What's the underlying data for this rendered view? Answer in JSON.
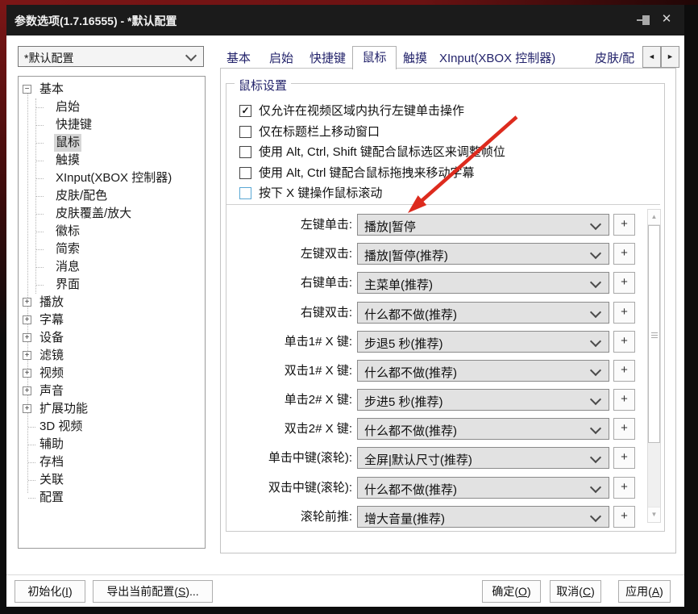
{
  "window": {
    "title": "参数选项(1.7.16555) - *默认配置",
    "icons": {
      "pin_icon": "pushpin",
      "close_icon": "✕"
    }
  },
  "profile_combo": {
    "value": "*默认配置"
  },
  "tree": {
    "items": [
      {
        "label": "基本",
        "expander": "−"
      },
      {
        "label": "启始",
        "expander": ""
      },
      {
        "label": "快捷键",
        "expander": ""
      },
      {
        "label": "鼠标",
        "expander": "",
        "selected": true
      },
      {
        "label": "触摸",
        "expander": ""
      },
      {
        "label": "XInput(XBOX 控制器)",
        "expander": ""
      },
      {
        "label": "皮肤/配色",
        "expander": ""
      },
      {
        "label": "皮肤覆盖/放大",
        "expander": ""
      },
      {
        "label": "徽标",
        "expander": ""
      },
      {
        "label": "简索",
        "expander": ""
      },
      {
        "label": "消息",
        "expander": ""
      },
      {
        "label": "界面",
        "expander": ""
      },
      {
        "label": "播放",
        "expander": "+"
      },
      {
        "label": "字幕",
        "expander": "+"
      },
      {
        "label": "设备",
        "expander": "+"
      },
      {
        "label": "滤镜",
        "expander": "+"
      },
      {
        "label": "视频",
        "expander": "+"
      },
      {
        "label": "声音",
        "expander": "+"
      },
      {
        "label": "扩展功能",
        "expander": "+"
      },
      {
        "label": "3D 视频",
        "expander": ""
      },
      {
        "label": "辅助",
        "expander": ""
      },
      {
        "label": "存档",
        "expander": ""
      },
      {
        "label": "关联",
        "expander": ""
      },
      {
        "label": "配置",
        "expander": ""
      }
    ]
  },
  "tabs": {
    "items": [
      {
        "label": "基本"
      },
      {
        "label": "启始"
      },
      {
        "label": "快捷键"
      },
      {
        "label": "鼠标",
        "active": true
      },
      {
        "label": "触摸"
      },
      {
        "label": "XInput(XBOX 控制器)"
      },
      {
        "label": "皮肤/配"
      }
    ],
    "scroll_left": "◄",
    "scroll_right": "►"
  },
  "panel": {
    "group_title": "鼠标设置",
    "checkboxes": [
      {
        "label": "仅允许在视频区域内执行左键单击操作",
        "checked": true,
        "mark": "✓"
      },
      {
        "label": "仅在标题栏上移动窗口",
        "checked": false,
        "mark": ""
      },
      {
        "label": "使用 Alt, Ctrl, Shift 键配合鼠标选区来调整帧位",
        "checked": false,
        "mark": ""
      },
      {
        "label": "使用 Alt, Ctrl 键配合鼠标拖拽来移动字幕",
        "checked": false,
        "mark": ""
      },
      {
        "label": "按下 X 键操作鼠标滚动",
        "checked": false,
        "mark": ""
      }
    ],
    "rows": [
      {
        "label": "左键单击:",
        "value": "播放|暂停"
      },
      {
        "label": "左键双击:",
        "value": "播放|暂停(推荐)"
      },
      {
        "label": "右键单击:",
        "value": "主菜单(推荐)"
      },
      {
        "label": "右键双击:",
        "value": "什么都不做(推荐)"
      },
      {
        "label": "单击1# X 键:",
        "value": "步退5 秒(推荐)"
      },
      {
        "label": "双击1# X 键:",
        "value": "什么都不做(推荐)"
      },
      {
        "label": "单击2# X 键:",
        "value": "步进5 秒(推荐)"
      },
      {
        "label": "双击2# X 键:",
        "value": "什么都不做(推荐)"
      },
      {
        "label": "单击中键(滚轮):",
        "value": "全屏|默认尺寸(推荐)"
      },
      {
        "label": "双击中键(滚轮):",
        "value": "什么都不做(推荐)"
      },
      {
        "label": "滚轮前推:",
        "value": "增大音量(推荐)"
      }
    ],
    "add_button_label": "+",
    "scrollbar": {
      "up_arrow": "▲",
      "down_arrow": "▼"
    }
  },
  "footer": {
    "buttons": {
      "init": {
        "pre": "初始化(",
        "key": "I",
        "post": ")"
      },
      "export": {
        "pre": "导出当前配置(",
        "key": "S",
        "post": ")..."
      },
      "ok": {
        "pre": "确定(",
        "key": "O",
        "post": ")"
      },
      "cancel": {
        "pre": "取消(",
        "key": "C",
        "post": ")"
      },
      "apply": {
        "pre": "应用(",
        "key": "A",
        "post": ")"
      }
    }
  },
  "annotation": {
    "arrow_color": "#dd2b1e"
  }
}
